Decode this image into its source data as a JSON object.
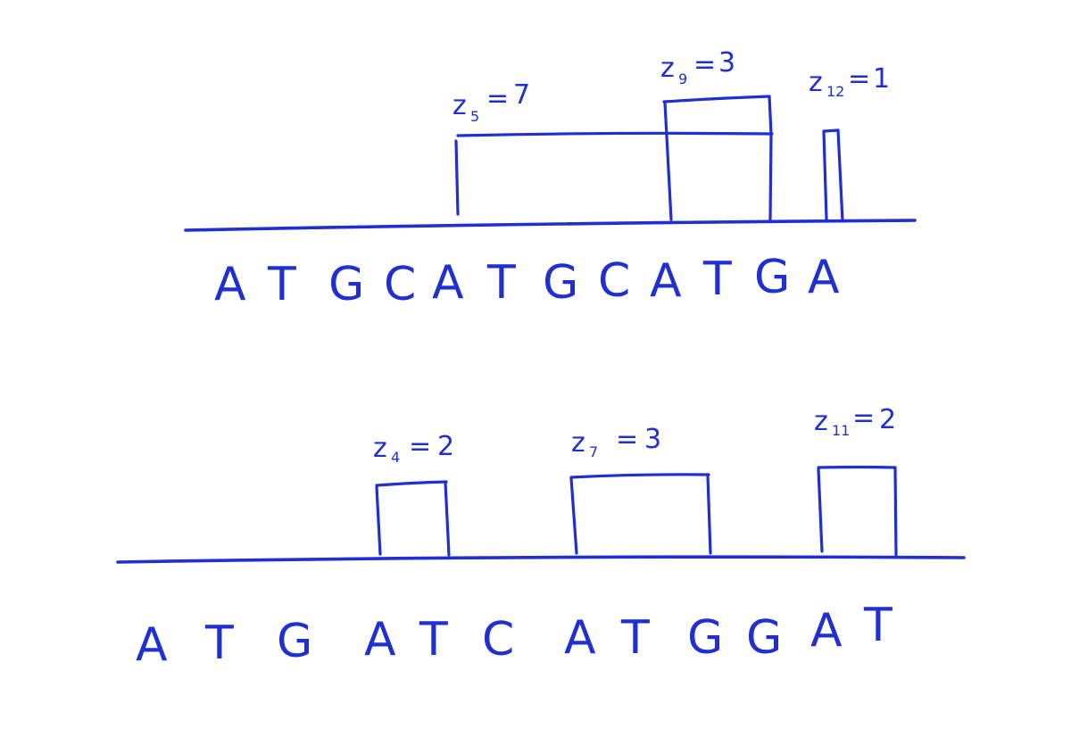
{
  "diagrams": [
    {
      "id": "top",
      "sequence": [
        "A",
        "T",
        "G",
        "C",
        "A",
        "T",
        "G",
        "C",
        "A",
        "T",
        "G",
        "A"
      ],
      "boxes": [
        {
          "label": "z",
          "subscript": "5",
          "value": "7"
        },
        {
          "label": "z",
          "subscript": "9",
          "value": "3"
        },
        {
          "label": "z",
          "subscript": "12",
          "value": "1"
        }
      ]
    },
    {
      "id": "bottom",
      "sequence": [
        "A",
        "T",
        "G",
        "A",
        "T",
        "C",
        "A",
        "T",
        "G",
        "G",
        "A",
        "T"
      ],
      "boxes": [
        {
          "label": "z",
          "subscript": "4",
          "value": "2"
        },
        {
          "label": "z",
          "subscript": "7",
          "value": "3"
        },
        {
          "label": "z",
          "subscript": "11",
          "value": "2"
        }
      ]
    }
  ],
  "colors": {
    "ink": "#1f2fd1",
    "background": "#ffffff"
  }
}
